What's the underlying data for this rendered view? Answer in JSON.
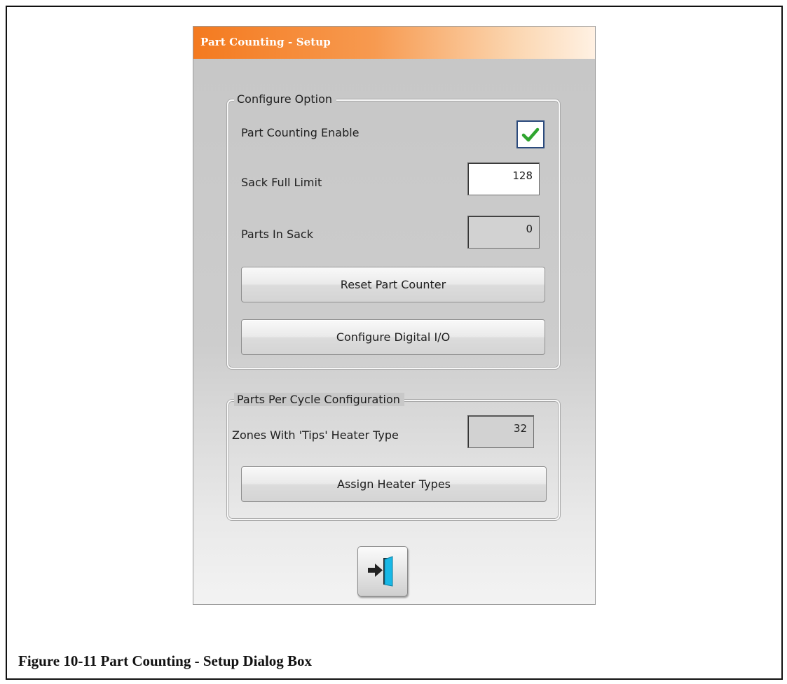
{
  "dialog": {
    "title": "Part Counting - Setup"
  },
  "configure_option": {
    "legend": "Configure Option",
    "part_counting_enable_label": "Part Counting Enable",
    "part_counting_enabled": true,
    "sack_full_limit_label": "Sack Full Limit",
    "sack_full_limit_value": "128",
    "parts_in_sack_label": "Parts In Sack",
    "parts_in_sack_value": "0",
    "reset_button_label": "Reset Part Counter",
    "configure_io_button_label": "Configure Digital I/O"
  },
  "parts_per_cycle": {
    "legend": "Parts Per Cycle Configuration",
    "zones_tips_label": "Zones With 'Tips' Heater Type",
    "zones_tips_value": "32",
    "assign_button_label": "Assign Heater Types"
  },
  "footer": {
    "exit_icon": "exit-door-icon"
  },
  "caption": "Figure 10-11  Part Counting - Setup Dialog Box",
  "colors": {
    "titlebar_accent": "#f47a1f",
    "checkmark": "#2fa52f",
    "door": "#18b8e6"
  }
}
